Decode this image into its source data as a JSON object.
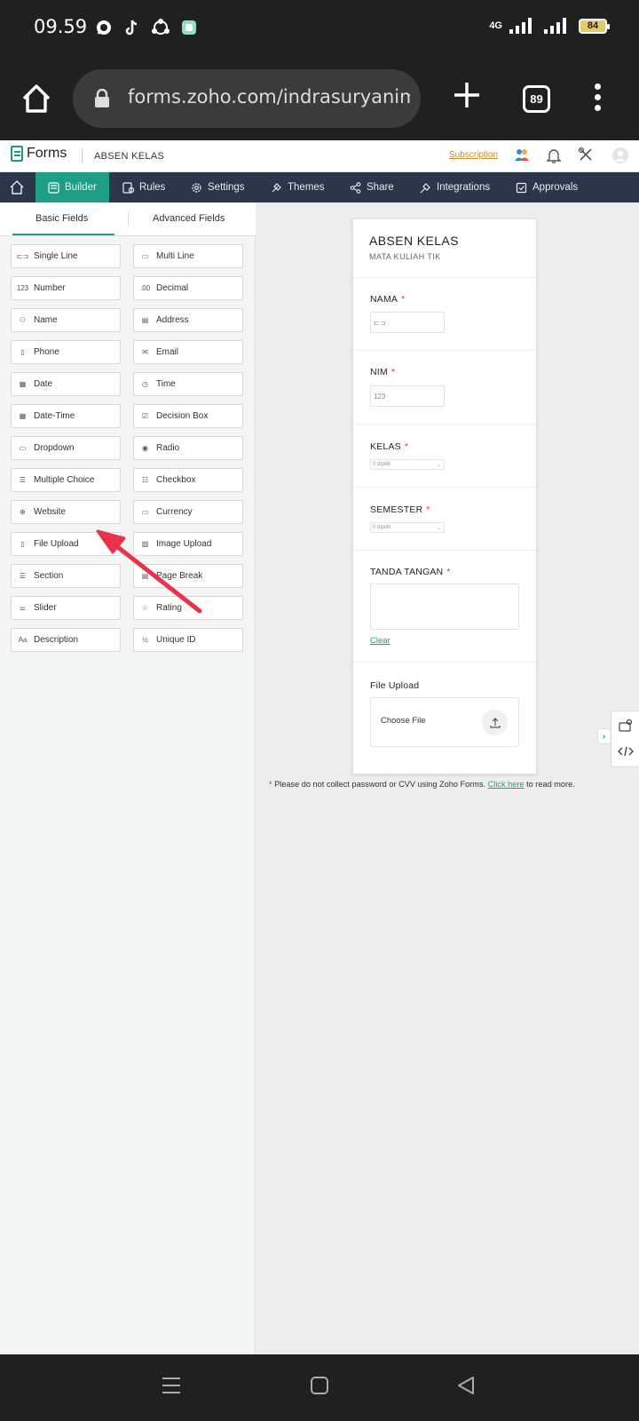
{
  "status_bar": {
    "time": "09.59",
    "network": "4G",
    "battery": "84",
    "notification_icons": [
      "whatsapp-icon",
      "tiktok-icon",
      "share-app-icon",
      "app-icon"
    ]
  },
  "browser": {
    "url": "forms.zoho.com/indrasuryanimust",
    "tab_count": "89"
  },
  "app_header": {
    "brand": "Forms",
    "form_name": "ABSEN KELAS",
    "subscription_link": "Subscription"
  },
  "nav": {
    "items": [
      {
        "label": "Builder",
        "icon": "builder-icon",
        "active": true
      },
      {
        "label": "Rules",
        "icon": "rules-icon"
      },
      {
        "label": "Settings",
        "icon": "gear-icon"
      },
      {
        "label": "Themes",
        "icon": "brush-icon"
      },
      {
        "label": "Share",
        "icon": "share-icon"
      },
      {
        "label": "Integrations",
        "icon": "plug-icon"
      },
      {
        "label": "Approvals",
        "icon": "approvals-icon"
      }
    ]
  },
  "field_tabs": {
    "basic": "Basic Fields",
    "advanced": "Advanced Fields"
  },
  "basic_fields": [
    {
      "label": "Single Line",
      "icon": "⊏⊐"
    },
    {
      "label": "Multi Line",
      "icon": "▭"
    },
    {
      "label": "Number",
      "icon": "123"
    },
    {
      "label": "Decimal",
      "icon": ".00"
    },
    {
      "label": "Name",
      "icon": "⚇"
    },
    {
      "label": "Address",
      "icon": "▤"
    },
    {
      "label": "Phone",
      "icon": "▯"
    },
    {
      "label": "Email",
      "icon": "✉"
    },
    {
      "label": "Date",
      "icon": "▦"
    },
    {
      "label": "Time",
      "icon": "◷"
    },
    {
      "label": "Date-Time",
      "icon": "▦"
    },
    {
      "label": "Decision Box",
      "icon": "☑"
    },
    {
      "label": "Dropdown",
      "icon": "▭"
    },
    {
      "label": "Radio",
      "icon": "◉"
    },
    {
      "label": "Multiple Choice",
      "icon": "☰"
    },
    {
      "label": "Checkbox",
      "icon": "☷"
    },
    {
      "label": "Website",
      "icon": "⊕"
    },
    {
      "label": "Currency",
      "icon": "▭"
    },
    {
      "label": "File Upload",
      "icon": "▯"
    },
    {
      "label": "Image Upload",
      "icon": "▨"
    },
    {
      "label": "Section",
      "icon": "☰"
    },
    {
      "label": "Page Break",
      "icon": "▤"
    },
    {
      "label": "Slider",
      "icon": "⚌"
    },
    {
      "label": "Rating",
      "icon": "☆"
    },
    {
      "label": "Description",
      "icon": "Aa"
    },
    {
      "label": "Unique ID",
      "icon": "½"
    }
  ],
  "form": {
    "title": "ABSEN KELAS",
    "subtitle": "MATA KULIAH TIK",
    "fields": [
      {
        "label": "NAMA",
        "required": "*",
        "type": "single-line",
        "placeholder": "⊏⊐"
      },
      {
        "label": "NIM",
        "required": "*",
        "type": "number",
        "placeholder": "123"
      },
      {
        "label": "KELAS",
        "required": "*",
        "type": "select",
        "placeholder": "0 dipilih"
      },
      {
        "label": "SEMESTER",
        "required": "*",
        "type": "select",
        "placeholder": "0 dipilih"
      },
      {
        "label": "TANDA TANGAN",
        "required": "*",
        "type": "signature",
        "action": "Clear"
      },
      {
        "label": "File Upload",
        "type": "file",
        "button": "Choose File"
      }
    ]
  },
  "notice": {
    "marker": "*",
    "text": "Please do not collect password or CVV using Zoho Forms.",
    "link": "Click here",
    "suffix": "to read more."
  },
  "annotation": {
    "arrow_color": "#e8334a",
    "points_to": "File Upload"
  },
  "colors": {
    "accent": "#1e9f85",
    "nav_bg": "#2c3648",
    "required": "#d23a3a",
    "subscription": "#c98b2f"
  }
}
